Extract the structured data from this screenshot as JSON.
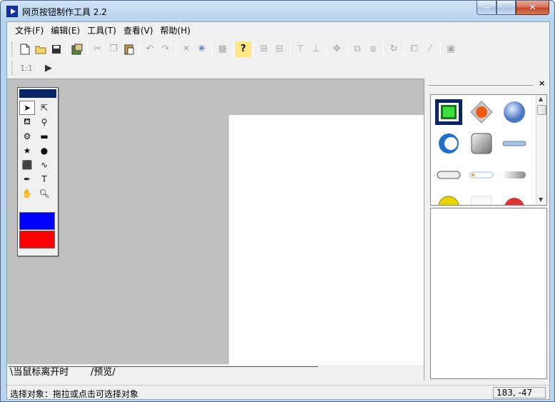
{
  "window": {
    "title": "网页按钮制作工具 2.2",
    "minimize": "—",
    "maximize": "□",
    "close": "✕"
  },
  "menu": [
    "文件(F)",
    "编辑(E)",
    "工具(T)",
    "查看(V)",
    "帮助(H)"
  ],
  "toolbar2": {
    "zoom_label": "1:1",
    "play": "▶"
  },
  "tabs": {
    "hover_tab": "\\当鼠标离开时",
    "preview_tab": "/预览/"
  },
  "panel": {
    "close": "×"
  },
  "status": {
    "text": "选择对象：拖拉或点击可选择对象",
    "coords": "183, -47"
  },
  "palette_colors": {
    "stroke": "#0000ff",
    "fill": "#ff0000"
  },
  "icons": {
    "toolbar1": [
      "new-file-icon",
      "open-folder-icon",
      "save-icon",
      "export-icon",
      "cut-icon",
      "copy-icon",
      "paste-icon",
      "undo-icon",
      "redo-icon",
      "delete-icon",
      "select-star-icon",
      "effects-icon",
      "help-icon",
      "align-left-icon",
      "align-right-icon",
      "align-top-icon",
      "align-bottom-icon",
      "center-icon",
      "bring-front-icon",
      "send-back-icon",
      "rotate-icon",
      "group-icon",
      "wand-icon",
      "ungroup-icon"
    ],
    "tools": [
      "arrow-select-icon",
      "node-select-icon",
      "fill-bucket-icon",
      "eyedropper-icon",
      "gear-shape-icon",
      "rectangle-icon",
      "star-icon",
      "circle-icon",
      "rounded-shape-icon",
      "freehand-icon",
      "pen-icon",
      "text-icon",
      "hand-icon",
      "zoom-icon"
    ],
    "gallery": [
      "green-square-button",
      "orange-diamond-button",
      "blue-sphere-button",
      "blue-ring-button",
      "gray-square-button",
      "slim-bar-button",
      "pill-button",
      "tabbed-bar-button",
      "gray-capsule-button",
      "yellow-circle-button",
      "white-tile-button",
      "red-arc-button"
    ]
  }
}
